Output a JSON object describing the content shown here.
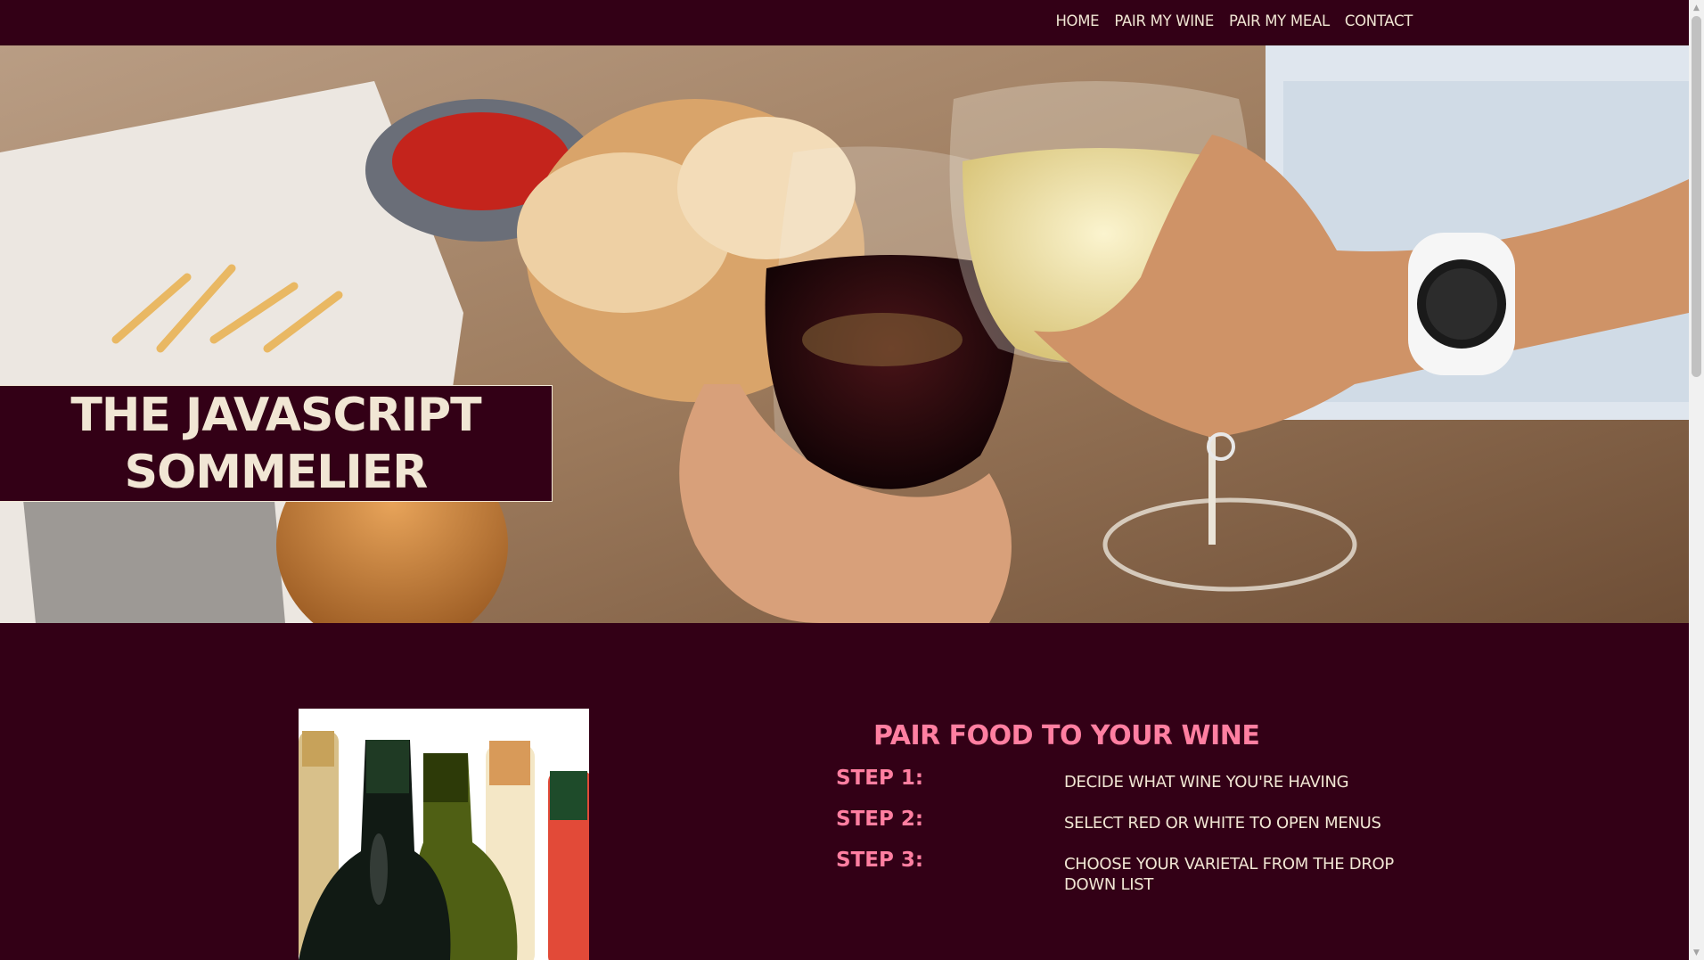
{
  "nav": {
    "items": [
      {
        "label": "HOME"
      },
      {
        "label": "PAIR MY WINE"
      },
      {
        "label": "PAIR MY MEAL"
      },
      {
        "label": "CONTACT"
      }
    ]
  },
  "hero": {
    "title_line1": "THE JAVASCRIPT",
    "title_line2": "SOMMELIER"
  },
  "content": {
    "heading": "PAIR FOOD TO YOUR WINE",
    "steps": [
      {
        "label": "STEP 1:",
        "text": "DECIDE WHAT WINE YOU'RE HAVING"
      },
      {
        "label": "STEP 2:",
        "text": "SELECT RED OR WHITE TO OPEN MENUS"
      },
      {
        "label": "STEP 3:",
        "text": "CHOOSE YOUR VARIETAL FROM THE DROP DOWN LIST"
      }
    ]
  },
  "colors": {
    "background": "#330016",
    "cream": "#f1e6d4",
    "accent_pink": "#ff7fa1"
  },
  "icons": {
    "scroll_up": "▲",
    "scroll_down": "▼"
  }
}
